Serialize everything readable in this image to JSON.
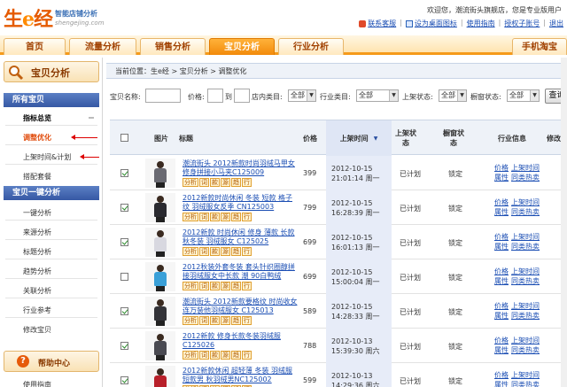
{
  "header": {
    "logo_main": "生",
    "logo_e": "e",
    "logo_tail": "经",
    "tagline": "智能店铺分析",
    "subdomain": "shengejing.com",
    "welcome": "欢迎您，潮流街头旗舰店，您是专业版用户",
    "links": [
      "联系客服",
      "设为桌面图标",
      "使用指南",
      "授权子账号",
      "退出"
    ]
  },
  "nav": {
    "items": [
      {
        "label": "首页"
      },
      {
        "label": "流量分析"
      },
      {
        "label": "销售分析"
      },
      {
        "label": "宝贝分析",
        "active": true
      },
      {
        "label": "行业分析"
      },
      {
        "label": "手机淘宝"
      }
    ]
  },
  "sidebar": {
    "title": "宝贝分析",
    "sections": [
      {
        "label": "所有宝贝",
        "items": [
          "指标总览",
          "调整优化",
          "上架时间&计划",
          "搭配套餐"
        ]
      },
      {
        "label": "宝贝一键分析",
        "items": [
          "一键分析",
          "来源分析",
          "标题分析",
          "趋势分析",
          "关联分析",
          "行业参考",
          "修改宝贝"
        ]
      }
    ],
    "help_icon": "?",
    "help_title": "帮助中心",
    "help_item": "使用指南"
  },
  "breadcrumb": "当前位置：生e经 > 宝贝分析 > 调整优化",
  "search": {
    "name_label": "宝贝名称:",
    "price_label": "价格:",
    "price_sep": "到",
    "category_label": "店内类目:",
    "category_value": "全部",
    "industry_label": "行业类目:",
    "industry_value": "全部",
    "status_label": "上架状态:",
    "status_value": "全部",
    "window_label": "橱窗状态:",
    "window_value": "全部",
    "query_button": "查询"
  },
  "table": {
    "headers": [
      "图片",
      "标题",
      "价格",
      "上架时间",
      "上架状态",
      "橱窗状态",
      "行业信息",
      "修改"
    ],
    "tag_labels": [
      "分析",
      "词",
      "款",
      "源",
      "趋",
      "行"
    ],
    "link_labels": [
      "价格",
      "上架时间",
      "属性",
      "同类热卖"
    ],
    "rows": [
      {
        "checked": true,
        "title": "潮流街头 2012新款时尚羽绒马甲女 修身拼接小马夹C125009",
        "price": "399",
        "time_date": "2012-10-15",
        "time_clock": "21:01:14 周一",
        "status": "已计划",
        "window": "锁定",
        "color": "#6a6a72"
      },
      {
        "checked": true,
        "title": "2012新款时尚休闲 冬装 短款 格子纹 羽绒服女反季 CN125003",
        "price": "799",
        "time_date": "2012-10-15",
        "time_clock": "16:28:39 周一",
        "status": "已计划",
        "window": "锁定",
        "color": "#2a2a30"
      },
      {
        "checked": true,
        "title": "2012新款 时尚休闲 修身 薄款 长款 秋冬装 羽绒服女 C125025",
        "price": "699",
        "time_date": "2012-10-15",
        "time_clock": "16:01:13 周一",
        "status": "已计划",
        "window": "锁定",
        "color": "#d8d8e0"
      },
      {
        "checked": false,
        "title": "2012秋装外套冬装 套头针织圈醇拼接羽绒服女中长款 潮 90白鸭绒",
        "price": "699",
        "time_date": "2012-10-15",
        "time_clock": "15:00:04 周一",
        "status": "已计划",
        "window": "锁定",
        "color": "#3aa0d8"
      },
      {
        "checked": true,
        "title": "潮流街头 2012新款要格纹 时尚收女连万装他羽绒服女 C125013",
        "price": "589",
        "time_date": "2012-10-15",
        "time_clock": "14:28:33 周一",
        "status": "已计划",
        "window": "锁定",
        "color": "#333338"
      },
      {
        "checked": true,
        "title": "2012新款 修身长款冬装羽绒服 C125026",
        "price": "788",
        "time_date": "2012-10-13",
        "time_clock": "15:39:30 周六",
        "status": "已计划",
        "window": "锁定",
        "color": "#4a4a52"
      },
      {
        "checked": true,
        "title": "2012新款休闲 超轻薄 冬装 羽绒服短款男 秋羽绒男NC125002",
        "price": "599",
        "time_date": "2012-10-13",
        "time_clock": "14:29:36 周六",
        "status": "已计划",
        "window": "锁定",
        "color": "#b8202a"
      }
    ]
  }
}
